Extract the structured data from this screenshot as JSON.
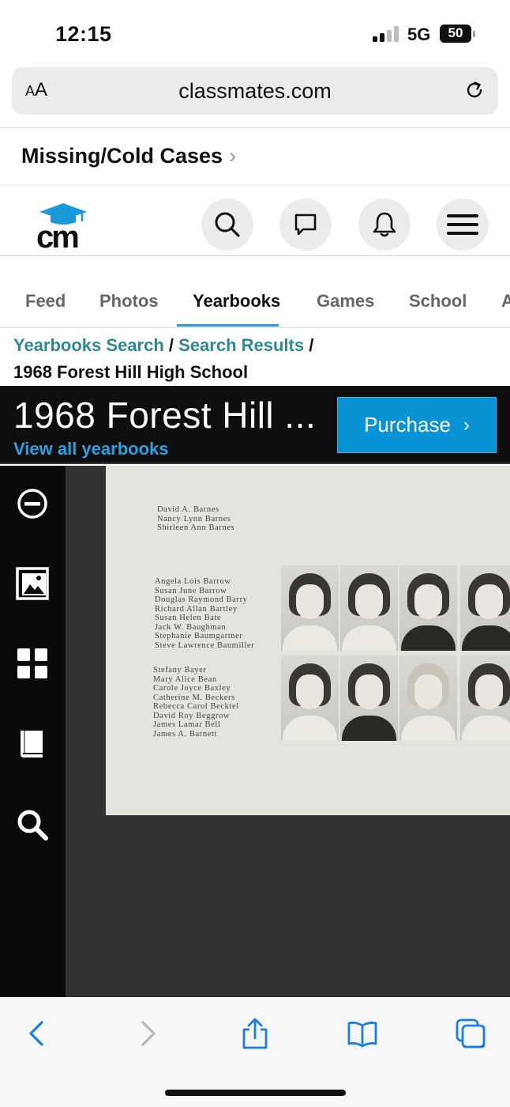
{
  "status": {
    "time": "12:15",
    "network": "5G",
    "battery_percent": 50,
    "battery_label": "50"
  },
  "browser": {
    "text_size_label_small": "A",
    "text_size_label_large": "A",
    "url": "classmates.com"
  },
  "banner": {
    "title": "Missing/Cold Cases",
    "chevron": "›"
  },
  "header": {
    "logo_text": "cm",
    "icons": [
      "search-icon",
      "message-icon",
      "bell-icon",
      "menu-icon"
    ]
  },
  "tabs": [
    {
      "label": "Feed"
    },
    {
      "label": "Photos"
    },
    {
      "label": "Yearbooks",
      "active": true
    },
    {
      "label": "Games"
    },
    {
      "label": "School"
    },
    {
      "label": "A"
    }
  ],
  "breadcrumb": {
    "link1": "Yearbooks Search",
    "sep1": " / ",
    "link2": "Search Results",
    "sep2": " /",
    "current": "1968 Forest Hill High School"
  },
  "viewer": {
    "title": "1968 Forest Hill ...",
    "view_all": "View all yearbooks",
    "purchase_label": "Purchase",
    "purchase_chevron": "›",
    "tools": [
      "zoom-out-icon",
      "gallery-icon",
      "grid-icon",
      "book-icon",
      "search-icon"
    ]
  },
  "yearbook_page": {
    "group1": [
      "David A. Barnes",
      "Nancy Lynn Barnes",
      "Shirleen Ann Barnes"
    ],
    "group2": [
      "Angela Lois Barrow",
      "Susan June Barrow",
      "Douglas Raymond Barry",
      "Richard Allan Bartley",
      "Susan Helen Bate",
      "Jack W. Baughman",
      "Stephanie Baumgartner",
      "Steve Lawrence Baumiller"
    ],
    "group3": [
      "Stefany Bayer",
      "Mary Alice Bean",
      "Carole Joyce Baxley",
      "Catherine M. Beckers",
      "Rebecca Carol Becktel",
      "David Roy Beggrow",
      "James Lamar Bell",
      "James A. Barnett"
    ]
  },
  "bottom_bar": {
    "icons": [
      "back-icon",
      "forward-icon",
      "share-icon",
      "bookmarks-icon",
      "tabs-icon"
    ]
  }
}
